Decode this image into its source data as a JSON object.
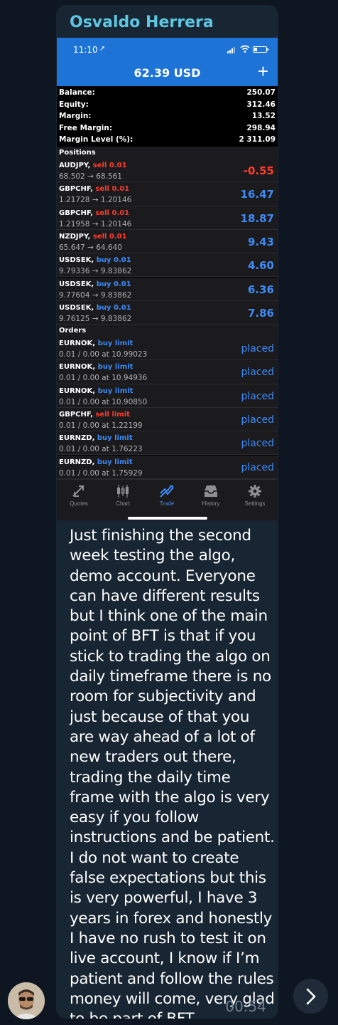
{
  "message": {
    "sender": "Osvaldo Herrera",
    "text": "Just finishing the second week testing the algo, demo account. Everyone can have different results but I think one of the main point of BFT is that if you stick to trading the algo on daily timeframe there is no room for subjectivity and just because of that you are way ahead of a lot of new traders out there, trading the daily time frame with the algo is very easy if you follow instructions and be patient. I do not want to create false expectations but this is very powerful, I have 3 years in forex and honestly I have no rush to test it on live account, I know if I’m patient and follow the rules money will come, very glad to be part of BFT",
    "time": "00:54"
  },
  "screenshot": {
    "status_time": "11:10",
    "header_title": "62.39 USD",
    "plus": "+",
    "account": [
      {
        "label": "Balance:",
        "value": "250.07"
      },
      {
        "label": "Equity:",
        "value": "312.46"
      },
      {
        "label": "Margin:",
        "value": "13.52"
      },
      {
        "label": "Free Margin:",
        "value": "298.94"
      },
      {
        "label": "Margin Level (%):",
        "value": "2 311.09"
      }
    ],
    "positions_title": "Positions",
    "positions": [
      {
        "symbol": "AUDJPY,",
        "side": "sell 0.01",
        "detail": "68.502 → 68.561",
        "pl": "-0.55"
      },
      {
        "symbol": "GBPCHF,",
        "side": "sell 0.01",
        "detail": "1.21728 → 1.20146",
        "pl": "16.47"
      },
      {
        "symbol": "GBPCHF,",
        "side": "sell 0.01",
        "detail": "1.21958 → 1.20146",
        "pl": "18.87"
      },
      {
        "symbol": "NZDJPY,",
        "side": "sell 0.01",
        "detail": "65.647 → 64.640",
        "pl": "9.43"
      },
      {
        "symbol": "USDSEK,",
        "side": "buy 0.01",
        "detail": "9.79336 → 9.83862",
        "pl": "4.60"
      },
      {
        "symbol": "USDSEK,",
        "side": "buy 0.01",
        "detail": "9.77604 → 9.83862",
        "pl": "6.36"
      },
      {
        "symbol": "USDSEK,",
        "side": "buy 0.01",
        "detail": "9.76125 → 9.83862",
        "pl": "7.86"
      }
    ],
    "orders_title": "Orders",
    "orders": [
      {
        "symbol": "EURNOK,",
        "side": "buy limit",
        "detail": "0.01 / 0.00 at 10.99023",
        "status": "placed"
      },
      {
        "symbol": "EURNOK,",
        "side": "buy limit",
        "detail": "0.01 / 0.00 at 10.94936",
        "status": "placed"
      },
      {
        "symbol": "EURNOK,",
        "side": "buy limit",
        "detail": "0.01 / 0.00 at 10.90850",
        "status": "placed"
      },
      {
        "symbol": "GBPCHF,",
        "side": "sell limit",
        "detail": "0.01 / 0.00 at 1.22199",
        "status": "placed"
      },
      {
        "symbol": "EURNZD,",
        "side": "buy limit",
        "detail": "0.01 / 0.00 at 1.76223",
        "status": "placed"
      },
      {
        "symbol": "EURNZD,",
        "side": "buy limit",
        "detail": "0.01 / 0.00 at 1.75929",
        "status": "placed"
      }
    ],
    "tabs": [
      {
        "label": "Quotes",
        "icon": "quotes-icon"
      },
      {
        "label": "Chart",
        "icon": "chart-icon"
      },
      {
        "label": "Trade",
        "icon": "trade-icon",
        "active": true
      },
      {
        "label": "History",
        "icon": "history-icon"
      },
      {
        "label": "Settings",
        "icon": "settings-icon"
      }
    ]
  },
  "colors": {
    "sell": "#ff3b30",
    "buy": "#3d8af7",
    "header": "#1e74d6",
    "sender": "#5fc6e2"
  }
}
